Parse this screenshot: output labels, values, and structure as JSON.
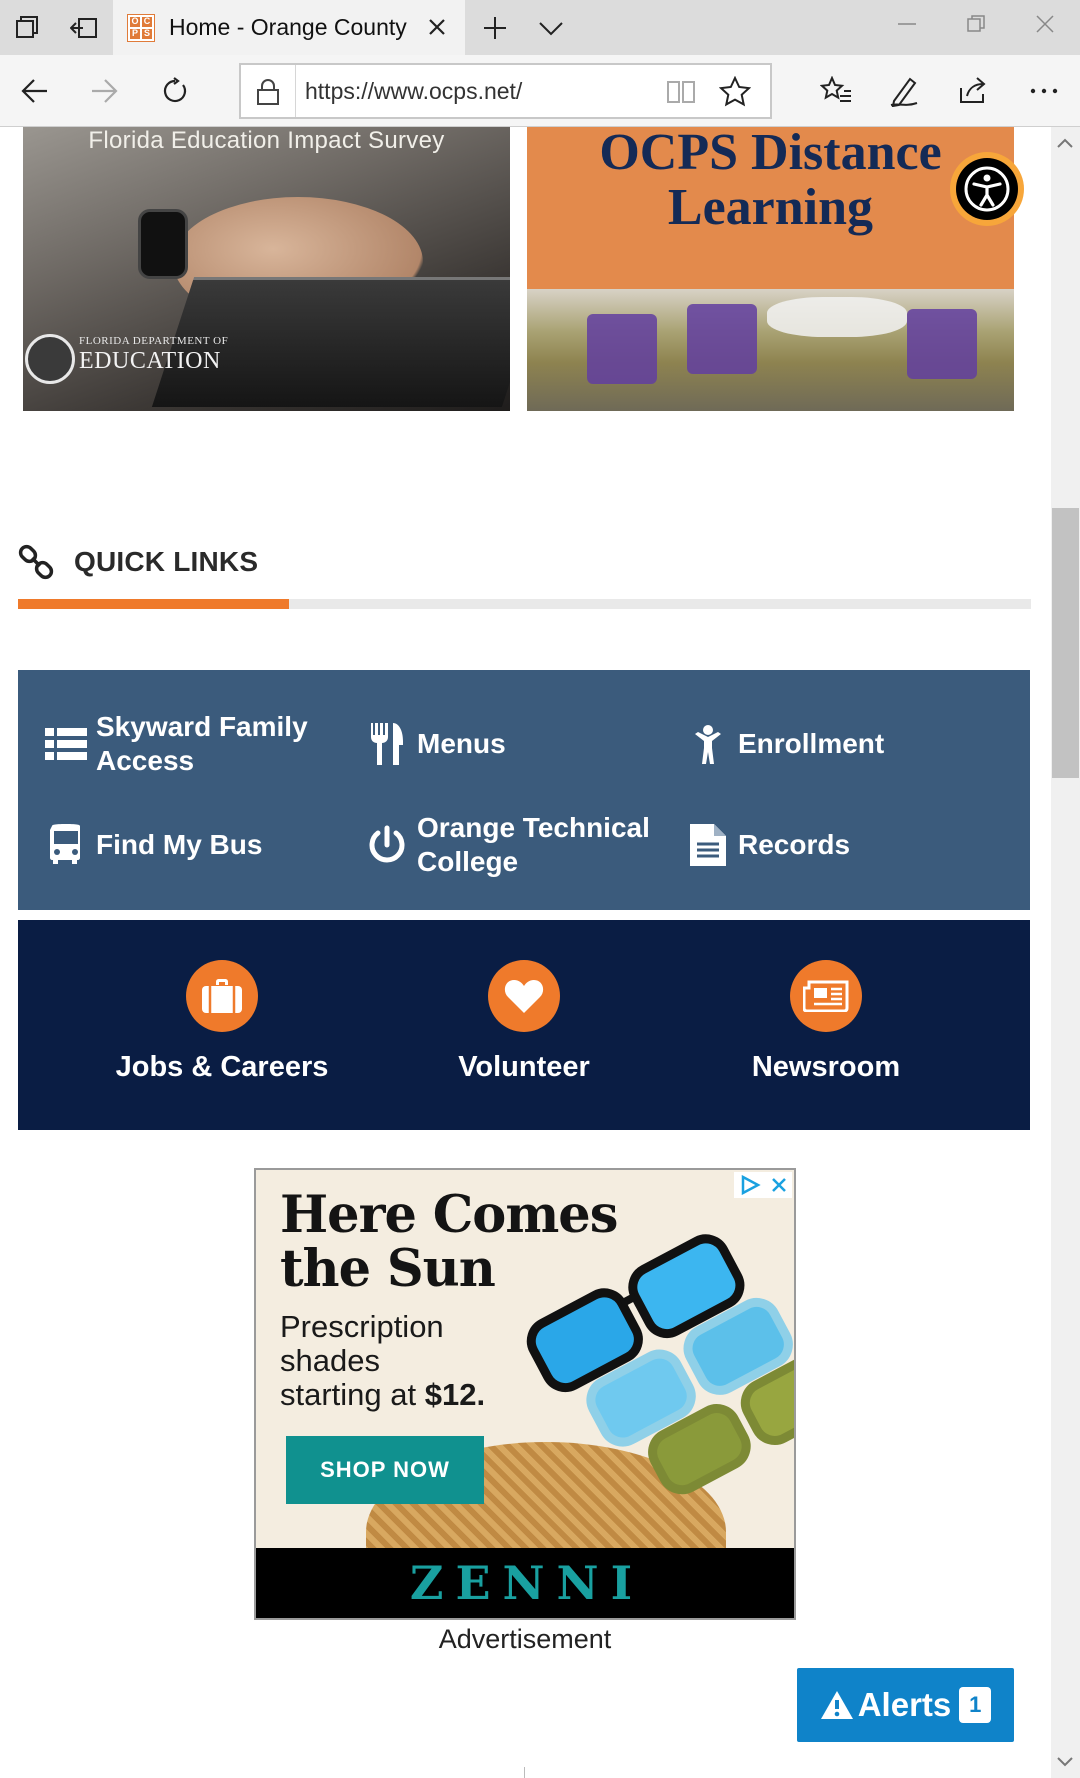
{
  "browser": {
    "tab_title": "Home - Orange County",
    "favicon_text": [
      "O",
      "C",
      "P",
      "S"
    ],
    "url": "https://www.ocps.net/"
  },
  "banners": {
    "left": {
      "caption": "Florida Education Impact Survey",
      "logo_small": "FLORIDA DEPARTMENT OF",
      "logo_big": "EDUCATION"
    },
    "right": {
      "title_line1": "OCPS Distance",
      "title_line2": "Learning"
    }
  },
  "quick_links": {
    "heading": "QUICK LINKS",
    "items": [
      {
        "label": "Skyward Family Access",
        "icon": "list-icon"
      },
      {
        "label": "Menus",
        "icon": "utensils-icon"
      },
      {
        "label": "Enrollment",
        "icon": "child-icon"
      },
      {
        "label": "Find My Bus",
        "icon": "bus-icon"
      },
      {
        "label": "Orange Technical College",
        "icon": "power-icon"
      },
      {
        "label": "Records",
        "icon": "document-icon"
      }
    ]
  },
  "cta": [
    {
      "label": "Jobs & Careers",
      "icon": "briefcase-icon"
    },
    {
      "label": "Volunteer",
      "icon": "heart-icon"
    },
    {
      "label": "Newsroom",
      "icon": "newspaper-icon"
    }
  ],
  "ad": {
    "headline_line1": "Here Comes",
    "headline_line2": "the Sun",
    "body_line1": "Prescription",
    "body_line2": "shades",
    "body_line3_prefix": "starting at ",
    "body_line3_price": "$12.",
    "button": "SHOP NOW",
    "brand": "ZENNI",
    "label": "Advertisement"
  },
  "alerts": {
    "label": "Alerts",
    "count": "1"
  },
  "colors": {
    "accent_orange": "#ef7a2b",
    "quick_links_panel": "#3b5b7c",
    "cta_panel": "#0a1d44",
    "alerts_blue": "#0f83c9"
  }
}
